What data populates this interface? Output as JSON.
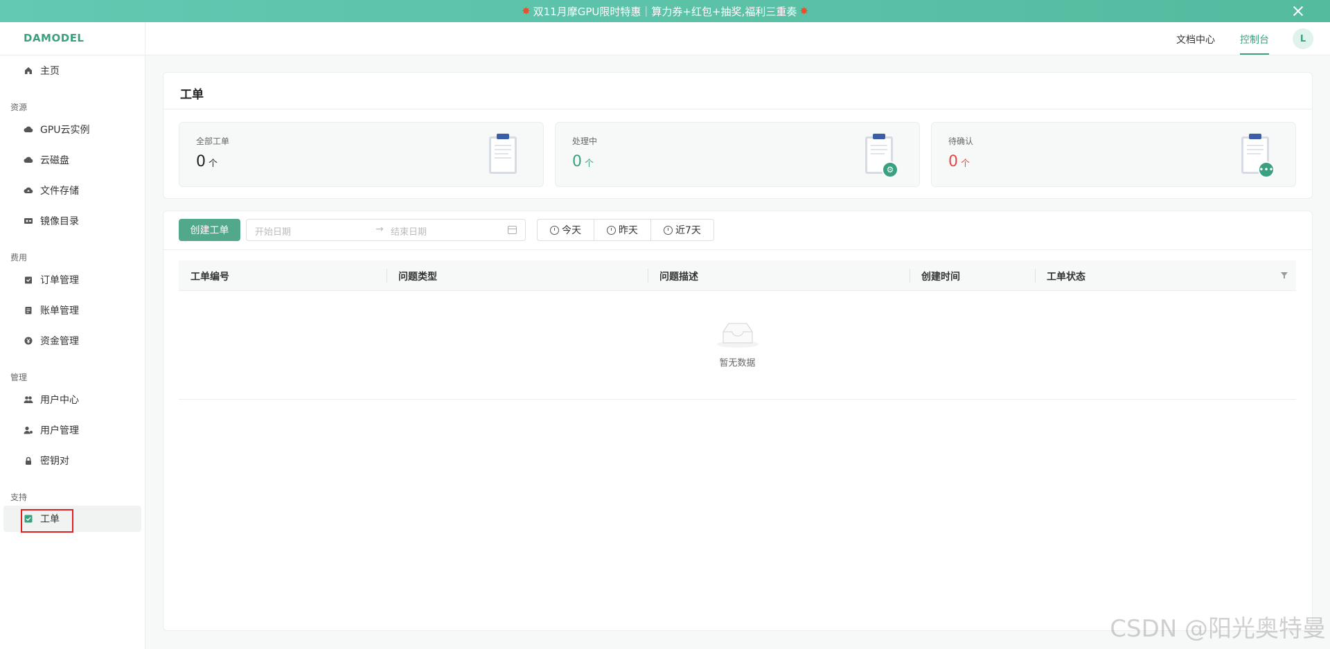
{
  "banner": {
    "text": "双11月摩GPU限时特惠｜算力券+红包+抽奖,福利三重奏",
    "burst_glyph": "✸"
  },
  "header": {
    "logo": "DAMODEL",
    "docs_link": "文档中心",
    "console_link": "控制台",
    "avatar_initial": "L"
  },
  "sidebar": {
    "home": "主页",
    "sections": {
      "resources": "资源",
      "billing": "费用",
      "management": "管理",
      "support": "支持"
    },
    "items": {
      "gpu": "GPU云实例",
      "disk": "云磁盘",
      "storage": "文件存储",
      "images": "镜像目录",
      "orders": "订单管理",
      "bills": "账单管理",
      "funds": "资金管理",
      "user_center": "用户中心",
      "user_manage": "用户管理",
      "keypair": "密钥对",
      "ticket": "工单"
    }
  },
  "main": {
    "title": "工单",
    "stats": [
      {
        "label": "全部工单",
        "value": "0",
        "unit": "个"
      },
      {
        "label": "处理中",
        "value": "0",
        "unit": "个"
      },
      {
        "label": "待确认",
        "value": "0",
        "unit": "个"
      }
    ],
    "create_button": "创建工单",
    "date_start_placeholder": "开始日期",
    "date_end_placeholder": "结束日期",
    "date_arrow": "→",
    "quick": {
      "today": "今天",
      "yesterday": "昨天",
      "last7": "近7天"
    },
    "table": {
      "columns": [
        "工单编号",
        "问题类型",
        "问题描述",
        "创建时间",
        "工单状态"
      ],
      "empty_text": "暂无数据"
    }
  },
  "watermark": "CSDN @阳光奥特曼",
  "colors": {
    "accent": "#3aa07f",
    "danger": "#e94545",
    "banner": "#5cc4ab"
  }
}
